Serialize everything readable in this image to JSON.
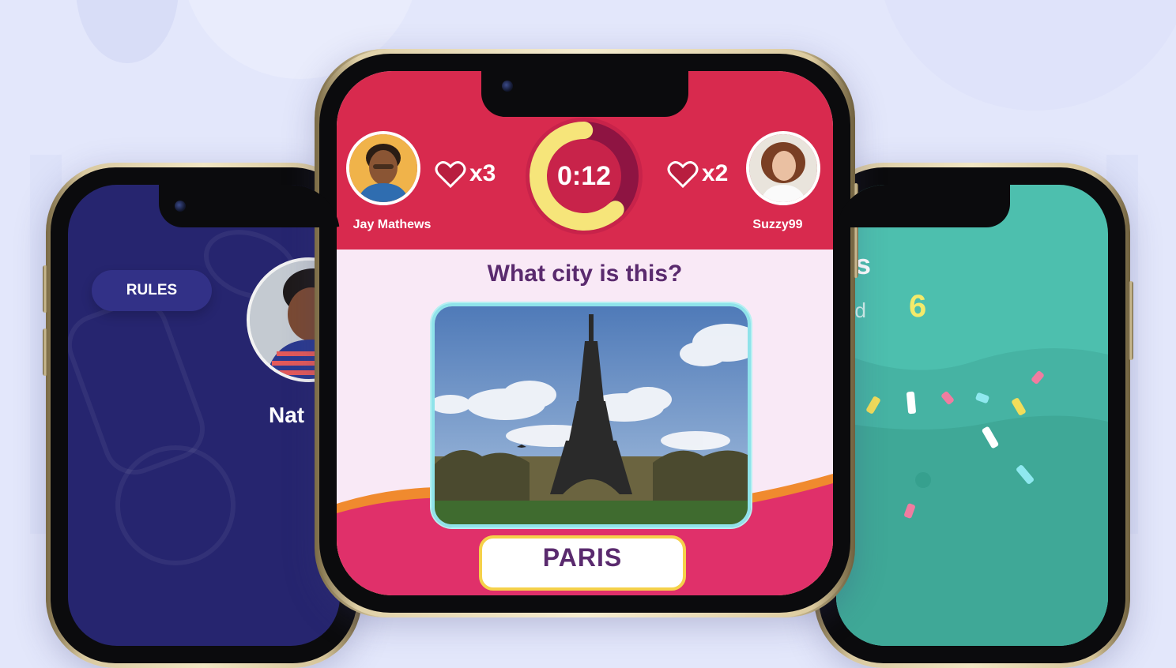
{
  "left_screen": {
    "rules_label": "RULES",
    "player_name_partial": "Nat"
  },
  "center_screen": {
    "player_left": {
      "name": "Jay Mathews",
      "lives": "x3"
    },
    "player_right": {
      "name": "Suzzy99",
      "lives": "x2"
    },
    "timer": "0:12",
    "timer_progress": 0.62,
    "question": "What city is this?",
    "answer_option": "PARIS"
  },
  "right_screen": {
    "title_partial": "ults",
    "subtitle_partial": "ked",
    "count": "6"
  },
  "colors": {
    "background": "#e3e7fb",
    "left_screen": "#26256f",
    "center_header": "#d82a4e",
    "center_body": "#f9e9f6",
    "right_screen": "#4dbfae",
    "timer_ring": "#f6e57a",
    "question_text": "#5a2a6e"
  }
}
